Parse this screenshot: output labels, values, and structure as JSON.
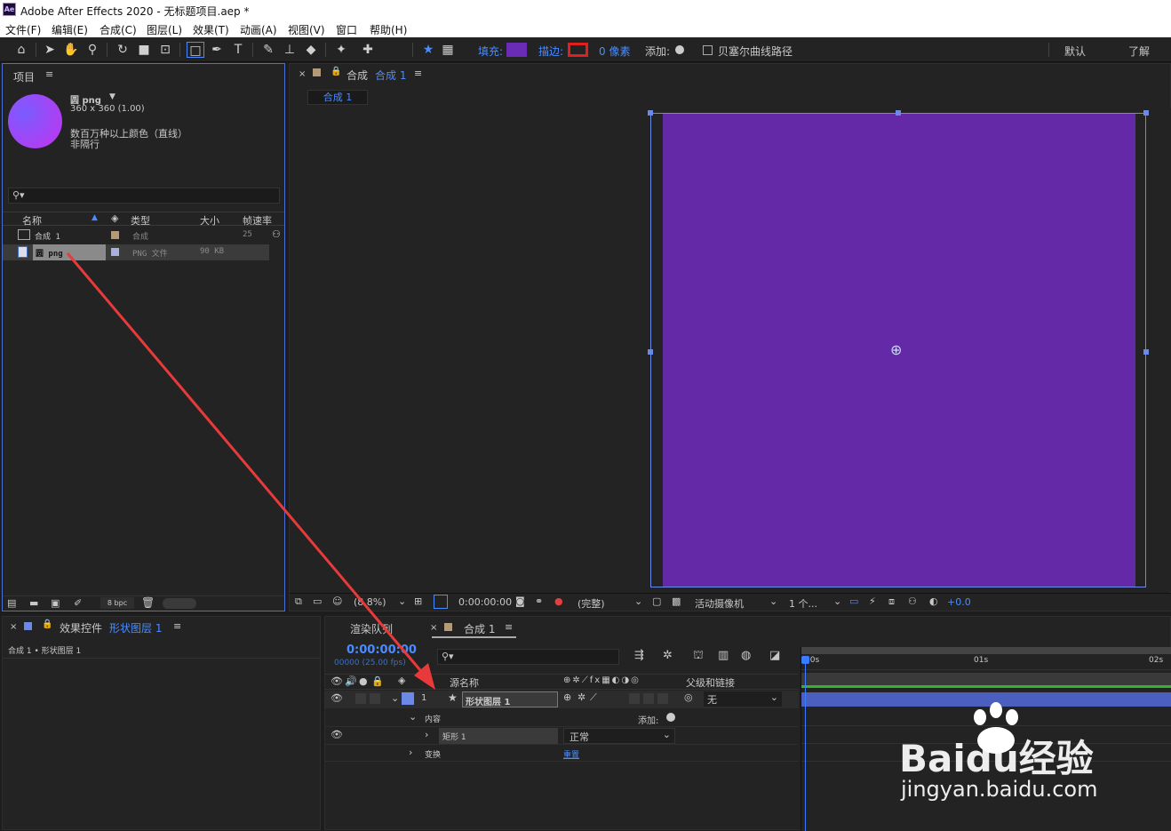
{
  "window": {
    "title": "Adobe After Effects 2020 - 无标题项目.aep *",
    "app_icon": "Ae"
  },
  "menu": [
    "文件(F)",
    "编辑(E)",
    "合成(C)",
    "图层(L)",
    "效果(T)",
    "动画(A)",
    "视图(V)",
    "窗口",
    "帮助(H)"
  ],
  "toolbar": {
    "fill_label": "填充:",
    "stroke_label": "描边:",
    "stroke_px": "0 像素",
    "add_label": "添加:",
    "bezier_label": "贝塞尔曲线路径",
    "workspace_default": "默认",
    "workspace_learn": "了解",
    "fill_color": "#6a2bb5",
    "stroke_color": "#e02020"
  },
  "project": {
    "title": "项目",
    "asset_name": "圆 png",
    "asset_dims": "360 x 360 (1.00)",
    "asset_color": "数百万种以上颜色（直线）",
    "asset_alpha": "非隔行",
    "columns": [
      "名称",
      "类型",
      "大小",
      "帧速率"
    ],
    "items": [
      {
        "name": "合成 1",
        "type": "合成",
        "size": "",
        "fps": "25"
      },
      {
        "name": "圆 png",
        "type": "PNG 文件",
        "size": "90 KB",
        "fps": ""
      }
    ],
    "bpc": "8 bpc"
  },
  "comp": {
    "tab_prefix": "合成",
    "tab_name": "合成 1",
    "breadcrumb": "合成 1",
    "bg_color": "#6329a6",
    "zoom": "(8.8%)",
    "timecode": "0:00:00:00",
    "resolution": "(完整)",
    "camera": "活动摄像机",
    "views": "1 个...",
    "exposure": "+0.0"
  },
  "effects": {
    "title_prefix": "效果控件",
    "title_layer": "形状图层 1",
    "breadcrumb": "合成 1 • 形状图层 1"
  },
  "timeline": {
    "tab_render": "渲染队列",
    "tab_comp": "合成 1",
    "timecode": "0:00:00:00",
    "frames": "00000 (25.00 fps)",
    "col_source": "源名称",
    "col_parent": "父级和链接",
    "layer": {
      "index": "1",
      "name": "形状图层 1",
      "parent": "无"
    },
    "contents_label": "内容",
    "add_label": "添加:",
    "rect_label": "矩形 1",
    "blend_mode": "正常",
    "transform_label": "变换",
    "reset_label": "重置",
    "ruler": [
      "00s",
      "01s",
      "02s"
    ]
  },
  "watermark": {
    "brand": "Baidu经验",
    "url": "jingyan.baidu.com"
  }
}
